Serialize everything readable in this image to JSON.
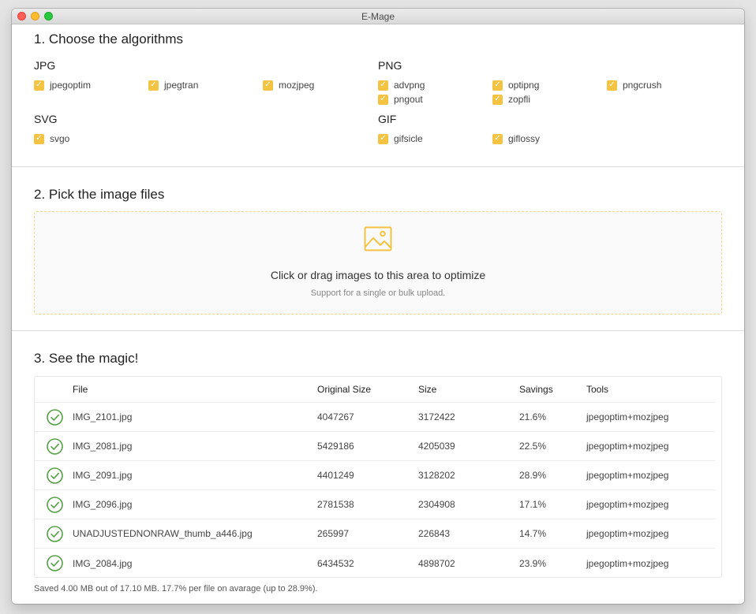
{
  "window": {
    "title": "E-Mage"
  },
  "step1": {
    "title": "1. Choose the algorithms",
    "jpg": {
      "label": "JPG",
      "items": [
        "jpegoptim",
        "jpegtran",
        "mozjpeg"
      ]
    },
    "png": {
      "label": "PNG",
      "items": [
        "advpng",
        "optipng",
        "pngcrush",
        "pngout",
        "zopfli"
      ]
    },
    "svg": {
      "label": "SVG",
      "items": [
        "svgo"
      ]
    },
    "gif": {
      "label": "GIF",
      "items": [
        "gifsicle",
        "giflossy"
      ]
    },
    "check_glyph": "✓"
  },
  "step2": {
    "title": "2. Pick the image files",
    "drop_text": "Click or drag images to this area to optimize",
    "drop_hint": "Support for a single or bulk upload.",
    "icon": "image-icon"
  },
  "step3": {
    "title": "3. See the magic!",
    "columns": {
      "file": "File",
      "original": "Original Size",
      "size": "Size",
      "savings": "Savings",
      "tools": "Tools"
    },
    "rows": [
      {
        "file": "IMG_2101.jpg",
        "original": "4047267",
        "size": "3172422",
        "savings": "21.6%",
        "tools": "jpegoptim+mozjpeg"
      },
      {
        "file": "IMG_2081.jpg",
        "original": "5429186",
        "size": "4205039",
        "savings": "22.5%",
        "tools": "jpegoptim+mozjpeg"
      },
      {
        "file": "IMG_2091.jpg",
        "original": "4401249",
        "size": "3128202",
        "savings": "28.9%",
        "tools": "jpegoptim+mozjpeg"
      },
      {
        "file": "IMG_2096.jpg",
        "original": "2781538",
        "size": "2304908",
        "savings": "17.1%",
        "tools": "jpegoptim+mozjpeg"
      },
      {
        "file": "UNADJUSTEDNONRAW_thumb_a446.jpg",
        "original": "265997",
        "size": "226843",
        "savings": "14.7%",
        "tools": "jpegoptim+mozjpeg"
      },
      {
        "file": "IMG_2084.jpg",
        "original": "6434532",
        "size": "4898702",
        "savings": "23.9%",
        "tools": "jpegoptim+mozjpeg"
      }
    ],
    "summary": "Saved 4.00 MB out of 17.10 MB. 17.7% per file on avarage (up to 28.9%)."
  },
  "colors": {
    "accent": "#f5c342",
    "success": "#52a043"
  }
}
